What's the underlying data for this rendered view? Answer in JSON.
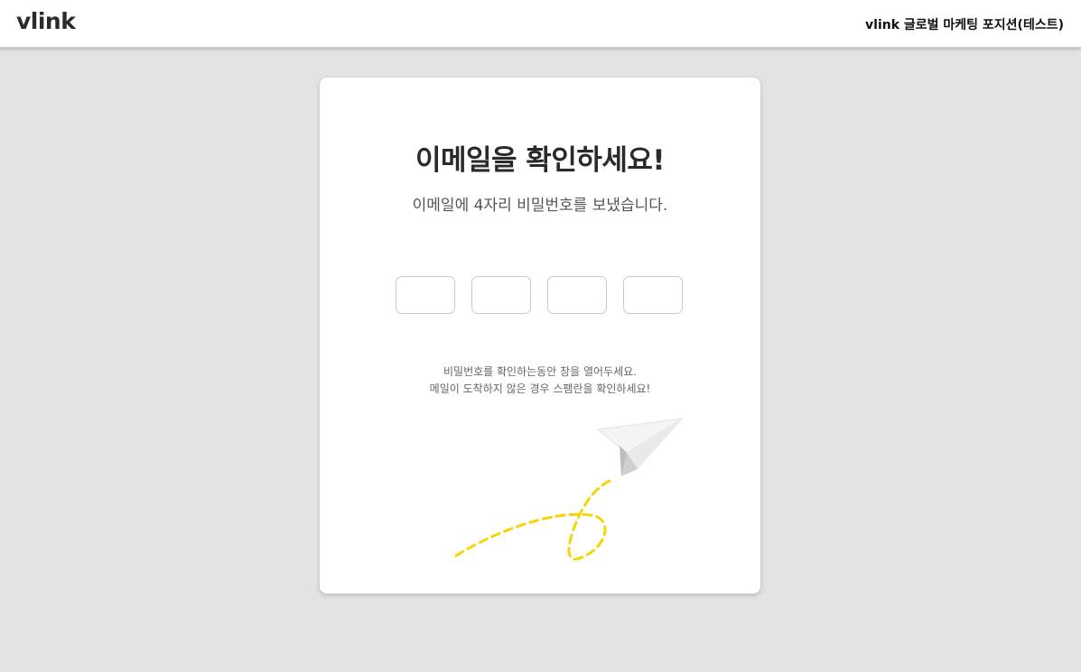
{
  "header": {
    "logo": "vlink",
    "position_title": "vlink 글로벌 마케팅 포지션(테스트)"
  },
  "card": {
    "title": "이메일을 확인하세요!",
    "subtitle": "이메일에 4자리 비밀번호를 보냈습니다.",
    "code_inputs": [
      "",
      "",
      "",
      ""
    ],
    "help_line_1": "비밀번호를 확인하는동안 창을 열어두세요.",
    "help_line_2": "메일이 도착하지 않은 경우 스팸란을 확인하세요!"
  },
  "colors": {
    "page_background": "#e4e2e3",
    "card_background": "#ffffff",
    "dashed_trail": "#f5d50a",
    "plane_light": "#f4f4f4",
    "plane_shade": "#d6d6d6"
  },
  "icons": {
    "illustration": "paper-plane-icon"
  }
}
